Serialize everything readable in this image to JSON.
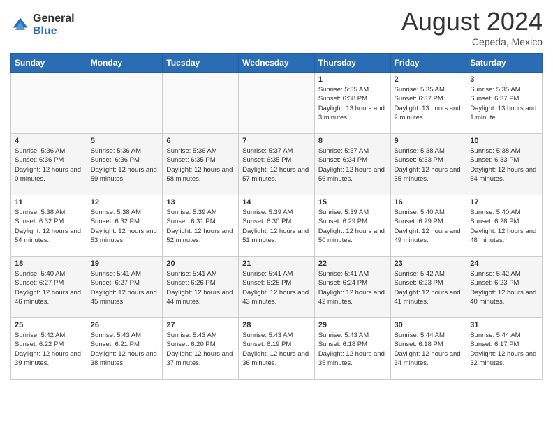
{
  "header": {
    "logo_general": "General",
    "logo_blue": "Blue",
    "month_year": "August 2024",
    "location": "Cepeda, Mexico"
  },
  "weekdays": [
    "Sunday",
    "Monday",
    "Tuesday",
    "Wednesday",
    "Thursday",
    "Friday",
    "Saturday"
  ],
  "weeks": [
    [
      {
        "day": "",
        "empty": true
      },
      {
        "day": "",
        "empty": true
      },
      {
        "day": "",
        "empty": true
      },
      {
        "day": "",
        "empty": true
      },
      {
        "day": "1",
        "sunrise": "5:35 AM",
        "sunset": "6:38 PM",
        "daylight": "13 hours and 3 minutes."
      },
      {
        "day": "2",
        "sunrise": "5:35 AM",
        "sunset": "6:37 PM",
        "daylight": "13 hours and 2 minutes."
      },
      {
        "day": "3",
        "sunrise": "5:35 AM",
        "sunset": "6:37 PM",
        "daylight": "13 hours and 1 minute."
      }
    ],
    [
      {
        "day": "4",
        "sunrise": "5:36 AM",
        "sunset": "6:36 PM",
        "daylight": "12 hours and 0 minutes."
      },
      {
        "day": "5",
        "sunrise": "5:36 AM",
        "sunset": "6:36 PM",
        "daylight": "12 hours and 59 minutes."
      },
      {
        "day": "6",
        "sunrise": "5:36 AM",
        "sunset": "6:35 PM",
        "daylight": "12 hours and 58 minutes."
      },
      {
        "day": "7",
        "sunrise": "5:37 AM",
        "sunset": "6:35 PM",
        "daylight": "12 hours and 57 minutes."
      },
      {
        "day": "8",
        "sunrise": "5:37 AM",
        "sunset": "6:34 PM",
        "daylight": "12 hours and 56 minutes."
      },
      {
        "day": "9",
        "sunrise": "5:38 AM",
        "sunset": "6:33 PM",
        "daylight": "12 hours and 55 minutes."
      },
      {
        "day": "10",
        "sunrise": "5:38 AM",
        "sunset": "6:33 PM",
        "daylight": "12 hours and 54 minutes."
      }
    ],
    [
      {
        "day": "11",
        "sunrise": "5:38 AM",
        "sunset": "6:32 PM",
        "daylight": "12 hours and 54 minutes."
      },
      {
        "day": "12",
        "sunrise": "5:38 AM",
        "sunset": "6:32 PM",
        "daylight": "12 hours and 53 minutes."
      },
      {
        "day": "13",
        "sunrise": "5:39 AM",
        "sunset": "6:31 PM",
        "daylight": "12 hours and 52 minutes."
      },
      {
        "day": "14",
        "sunrise": "5:39 AM",
        "sunset": "6:30 PM",
        "daylight": "12 hours and 51 minutes."
      },
      {
        "day": "15",
        "sunrise": "5:39 AM",
        "sunset": "6:29 PM",
        "daylight": "12 hours and 50 minutes."
      },
      {
        "day": "16",
        "sunrise": "5:40 AM",
        "sunset": "6:29 PM",
        "daylight": "12 hours and 49 minutes."
      },
      {
        "day": "17",
        "sunrise": "5:40 AM",
        "sunset": "6:28 PM",
        "daylight": "12 hours and 48 minutes."
      }
    ],
    [
      {
        "day": "18",
        "sunrise": "5:40 AM",
        "sunset": "6:27 PM",
        "daylight": "12 hours and 46 minutes."
      },
      {
        "day": "19",
        "sunrise": "5:41 AM",
        "sunset": "6:27 PM",
        "daylight": "12 hours and 45 minutes."
      },
      {
        "day": "20",
        "sunrise": "5:41 AM",
        "sunset": "6:26 PM",
        "daylight": "12 hours and 44 minutes."
      },
      {
        "day": "21",
        "sunrise": "5:41 AM",
        "sunset": "6:25 PM",
        "daylight": "12 hours and 43 minutes."
      },
      {
        "day": "22",
        "sunrise": "5:41 AM",
        "sunset": "6:24 PM",
        "daylight": "12 hours and 42 minutes."
      },
      {
        "day": "23",
        "sunrise": "5:42 AM",
        "sunset": "6:23 PM",
        "daylight": "12 hours and 41 minutes."
      },
      {
        "day": "24",
        "sunrise": "5:42 AM",
        "sunset": "6:23 PM",
        "daylight": "12 hours and 40 minutes."
      }
    ],
    [
      {
        "day": "25",
        "sunrise": "5:42 AM",
        "sunset": "6:22 PM",
        "daylight": "12 hours and 39 minutes."
      },
      {
        "day": "26",
        "sunrise": "5:43 AM",
        "sunset": "6:21 PM",
        "daylight": "12 hours and 38 minutes."
      },
      {
        "day": "27",
        "sunrise": "5:43 AM",
        "sunset": "6:20 PM",
        "daylight": "12 hours and 37 minutes."
      },
      {
        "day": "28",
        "sunrise": "5:43 AM",
        "sunset": "6:19 PM",
        "daylight": "12 hours and 36 minutes."
      },
      {
        "day": "29",
        "sunrise": "5:43 AM",
        "sunset": "6:18 PM",
        "daylight": "12 hours and 35 minutes."
      },
      {
        "day": "30",
        "sunrise": "5:44 AM",
        "sunset": "6:18 PM",
        "daylight": "12 hours and 34 minutes."
      },
      {
        "day": "31",
        "sunrise": "5:44 AM",
        "sunset": "6:17 PM",
        "daylight": "12 hours and 32 minutes."
      }
    ]
  ]
}
